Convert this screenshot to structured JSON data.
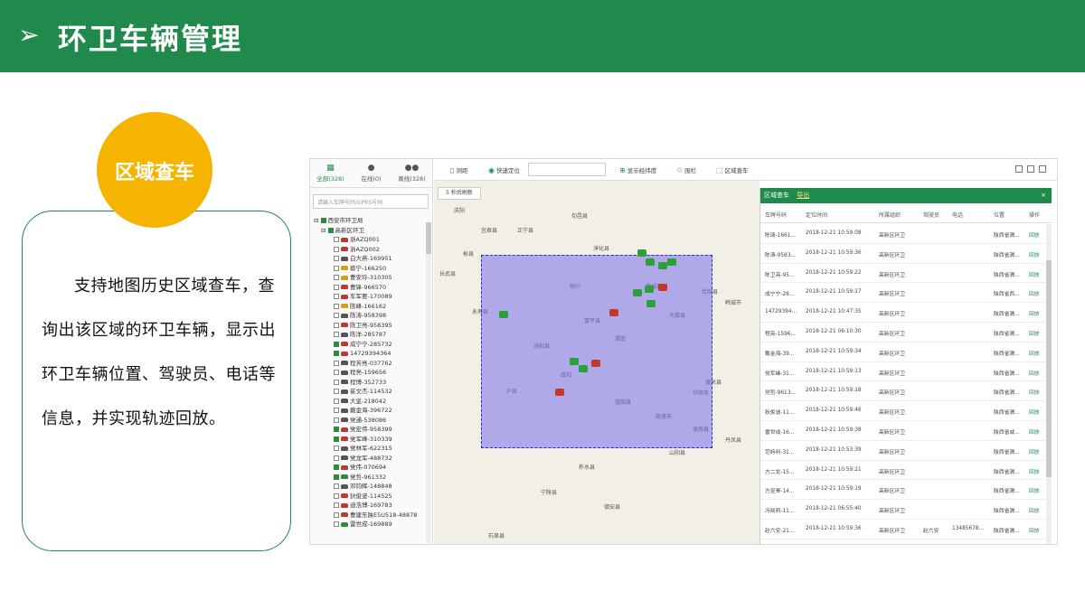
{
  "header": {
    "title": "环卫车辆管理",
    "arrow": "➢"
  },
  "badge": {
    "label": "区域查车"
  },
  "description": "支持地图历史区域查车，查询出该区域的环卫车辆，显示出环卫车辆位置、驾驶员、电话等信息，并实现轨迹回放。",
  "app": {
    "tabs": [
      {
        "label": "全部(328)",
        "icon": "grid-icon"
      },
      {
        "label": "在线(0)",
        "icon": "user-icon"
      },
      {
        "label": "离线(328)",
        "icon": "user-group-icon"
      }
    ],
    "search_placeholder": "请输入车牌号码/GPRS号码",
    "tree_root": "西安市环卫局",
    "tree_group": "高新区环卫",
    "vehicles": [
      {
        "name": "浙AZQ001",
        "checked": false,
        "color": "#c0392b"
      },
      {
        "name": "浙AZQ002",
        "checked": false,
        "color": "#c0392b"
      },
      {
        "name": "白大燕-169951",
        "checked": false,
        "color": "#555555"
      },
      {
        "name": "蔡宁-166250",
        "checked": false,
        "color": "#d4a017"
      },
      {
        "name": "曹安玲-310305",
        "checked": false,
        "color": "#d4a017"
      },
      {
        "name": "曹锋-966570",
        "checked": false,
        "color": "#c0392b"
      },
      {
        "name": "车军要-170089",
        "checked": false,
        "color": "#c0392b"
      },
      {
        "name": "陈峰-166162",
        "checked": false,
        "color": "#d4a017"
      },
      {
        "name": "陈涛-958398",
        "checked": false,
        "color": "#555555"
      },
      {
        "name": "陈卫亮-958395",
        "checked": false,
        "color": "#c0392b"
      },
      {
        "name": "陈洋-285787",
        "checked": false,
        "color": "#555555"
      },
      {
        "name": "成宁宁-285732",
        "checked": true,
        "color": "#c0392b"
      },
      {
        "name": "14729394364",
        "checked": true,
        "color": "#c0392b"
      },
      {
        "name": "程芳亮-037762",
        "checked": false,
        "color": "#555555"
      },
      {
        "name": "程亮-159656",
        "checked": false,
        "color": "#555555"
      },
      {
        "name": "程博-352733",
        "checked": false,
        "color": "#555555"
      },
      {
        "name": "崔文杰-114532",
        "checked": false,
        "color": "#555555"
      },
      {
        "name": "大皇-218042",
        "checked": false,
        "color": "#555555"
      },
      {
        "name": "戴金海-396722",
        "checked": false,
        "color": "#555555"
      },
      {
        "name": "党通-538086",
        "checked": false,
        "color": "#555555"
      },
      {
        "name": "党宏伟-958399",
        "checked": true,
        "color": "#c0392b"
      },
      {
        "name": "党军峰-310339",
        "checked": true,
        "color": "#c0392b"
      },
      {
        "name": "党林军-622315",
        "checked": false,
        "color": "#555555"
      },
      {
        "name": "党龙军-488732",
        "checked": false,
        "color": "#555555"
      },
      {
        "name": "党伟-070694",
        "checked": true,
        "color": "#c0392b"
      },
      {
        "name": "党哲-961332",
        "checked": true,
        "color": "#2e8b3d"
      },
      {
        "name": "邓钧辉-148848",
        "checked": false,
        "color": "#555555"
      },
      {
        "name": "狄俊波-114525",
        "checked": false,
        "color": "#c0392b"
      },
      {
        "name": "迪浩博-169783",
        "checked": false,
        "color": "#c0392b"
      },
      {
        "name": "曹建东陕E5U518-48878",
        "checked": false,
        "color": "#c0392b"
      },
      {
        "name": "雷世成-169889",
        "checked": false,
        "color": "#2e8b3d"
      }
    ],
    "toolbar": {
      "measure": "测距",
      "quick_locate": "快速定位",
      "show_coords": "显示经纬度",
      "fence": "围栏",
      "area_search": "区域查车"
    },
    "map": {
      "refresh": "5 秒后刷新",
      "labels": [
        "庆阳",
        "宜君县",
        "正宁县",
        "旬邑县",
        "淳化县",
        "永寿县",
        "铜川",
        "富平县",
        "大荔县",
        "渭南",
        "咸阳",
        "户县",
        "蓝田县",
        "商洛市",
        "山阳县",
        "宁陕县",
        "石泉县",
        "镇安县",
        "柞水县",
        "彬县",
        "长武县",
        "华阴市",
        "潼关县",
        "蒲城县",
        "合阳县",
        "韩城市",
        "洛南县",
        "丹凤县",
        "泾阳县"
      ]
    },
    "result": {
      "title": "区域查车",
      "export": "导出",
      "close": "×",
      "columns": [
        "车牌号码",
        "定位时间",
        "所属组织",
        "驾驶员",
        "电话",
        "位置",
        "操作"
      ],
      "rows": [
        [
          "陈琦-1661...",
          "2018-12-21 10:59:08",
          "高新区环卫",
          "",
          "",
          "陕西省渭...",
          "回放"
        ],
        [
          "陈涛-9583...",
          "2018-12-21 10:59:36",
          "高新区环卫",
          "",
          "",
          "陕西省渭...",
          "回放"
        ],
        [
          "陈卫亮-95...",
          "2018-12-21 10:59:22",
          "高新区环卫",
          "",
          "",
          "陕西省渭...",
          "回放"
        ],
        [
          "成宁宁-28...",
          "2018-12-21 10:59:17",
          "高新区环卫",
          "",
          "",
          "陕西省西...",
          "回放"
        ],
        [
          "14729394...",
          "2018-12-21 10:47:35",
          "高新区环卫",
          "",
          "",
          "陕西省渭...",
          "回放"
        ],
        [
          "程亮-1596...",
          "2018-12-21 06:10:30",
          "高新区环卫",
          "",
          "",
          "陕西省渭...",
          "回放"
        ],
        [
          "戴金海-39...",
          "2018-12-21 10:59:34",
          "高新区环卫",
          "",
          "",
          "陕西省渭...",
          "回放"
        ],
        [
          "党军峰-31...",
          "2018-12-21 10:59:13",
          "高新区环卫",
          "",
          "",
          "陕西省渭...",
          "回放"
        ],
        [
          "党哲-9613...",
          "2018-12-21 10:59:18",
          "高新区环卫",
          "",
          "",
          "陕西省渭...",
          "回放"
        ],
        [
          "狄俊波-11...",
          "2018-12-21 10:59:46",
          "高新区环卫",
          "",
          "",
          "陕西省渭...",
          "回放"
        ],
        [
          "雷世成-16...",
          "2018-12-21 10:59:38",
          "高新区环卫",
          "",
          "",
          "陕西省咸...",
          "回放"
        ],
        [
          "范峙利-31...",
          "2018-12-21 10:53:39",
          "高新区环卫",
          "",
          "",
          "陕西省渭...",
          "回放"
        ],
        [
          "方二龙-15...",
          "2018-12-21 10:59:21",
          "高新区环卫",
          "",
          "",
          "陕西省渭...",
          "回放"
        ],
        [
          "方昱昊-14...",
          "2018-12-21 10:59:19",
          "高新区环卫",
          "",
          "",
          "陕西省渭...",
          "回放"
        ],
        [
          "冯晓莉-11...",
          "2018-12-21 06:55:40",
          "高新区环卫",
          "",
          "",
          "陕西省渭...",
          "回放"
        ],
        [
          "赵六安-21...",
          "2018-12-21 10:59:36",
          "高新区环卫",
          "赵六安",
          "13485678...",
          "陕西省渭...",
          "回放"
        ]
      ]
    }
  }
}
